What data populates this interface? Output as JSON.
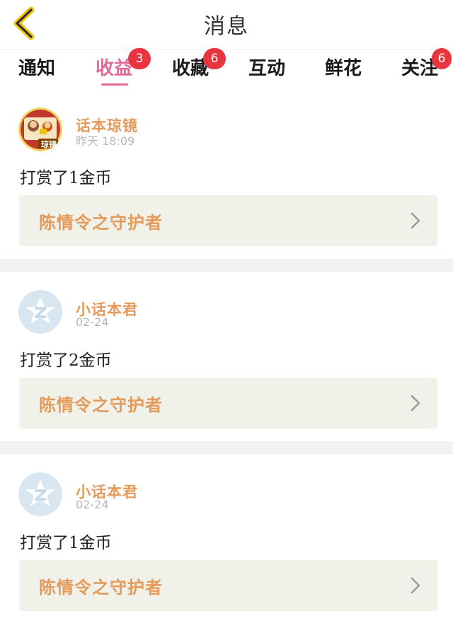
{
  "header": {
    "title": "消息",
    "back_icon": "chevron-left-icon"
  },
  "tabs": [
    {
      "label": "通知",
      "badge": "",
      "active": false
    },
    {
      "label": "收益",
      "badge": "3",
      "active": true
    },
    {
      "label": "收藏",
      "badge": "6",
      "active": false
    },
    {
      "label": "互动",
      "badge": "",
      "active": false
    },
    {
      "label": "鲜花",
      "badge": "",
      "active": false
    },
    {
      "label": "关注",
      "badge": "6",
      "active": false
    }
  ],
  "messages": [
    {
      "username": "话本琼镜",
      "time": "昨天  18:09",
      "text": "打赏了1金币",
      "link_title": "陈情令之守护者",
      "avatar_text": "琼镜",
      "avatar": "illustrated-avatar"
    },
    {
      "username": "小话本君",
      "time": "02-24",
      "text": "打赏了2金币",
      "link_title": "陈情令之守护者",
      "avatar": "default-z-avatar"
    },
    {
      "username": "小话本君",
      "time": "02-24",
      "text": "打赏了1金币",
      "link_title": "陈情令之守护者",
      "avatar": "default-z-avatar"
    }
  ],
  "colors": {
    "accent_pink": "#e0699a",
    "badge_red": "#e8353f",
    "username_orange": "#e39a5b",
    "linkbox_bg": "#f0f2e9",
    "back_yellow": "#f1c40f"
  }
}
